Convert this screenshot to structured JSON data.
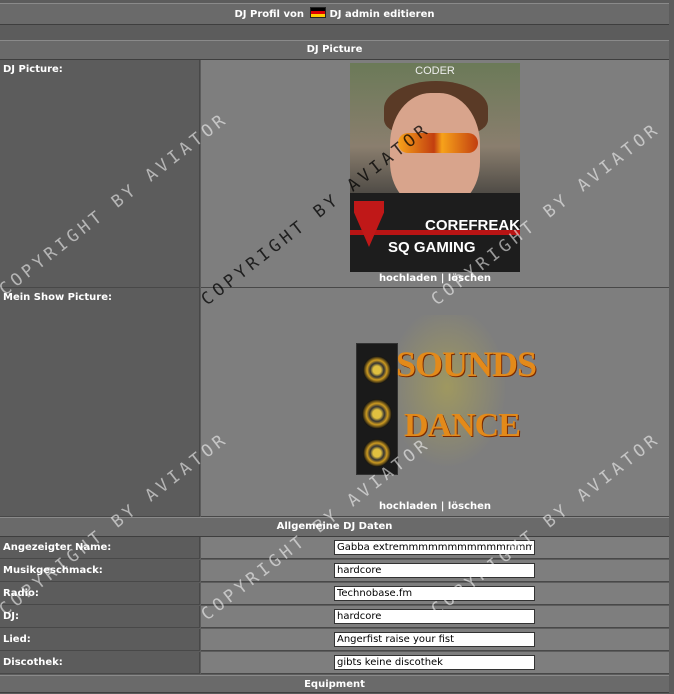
{
  "header": {
    "title_prefix": "DJ Profil von",
    "dj_name": "DJ admin",
    "title_suffix": "editieren",
    "flag_icon": "germany-flag-icon"
  },
  "picture_section": {
    "title": "DJ Picture",
    "dj_picture_label": "DJ Picture:",
    "dj_picture_texts": {
      "top": "CODER",
      "name": "COREFREAK",
      "team": "SQ GAMING"
    },
    "show_picture_label": "Mein Show Picture:",
    "show_picture_texts": {
      "line1": "SOUNDS",
      "line2": "DANCE"
    },
    "upload_label": "hochladen",
    "separator": "|",
    "delete_label": "löschen"
  },
  "general_section": {
    "title": "Allgemeine DJ Daten",
    "fields": [
      {
        "label": "Angezeigter Name:",
        "value": "Gabba extremmmmmmmmmmmmmmmmm"
      },
      {
        "label": "Musikgeschmack:",
        "value": "hardcore"
      },
      {
        "label": "Radio:",
        "value": "Technobase.fm"
      },
      {
        "label": "DJ:",
        "value": "hardcore"
      },
      {
        "label": "Lied:",
        "value": "Angerfist raise your fist"
      },
      {
        "label": "Discothek:",
        "value": "gibts keine discothek"
      }
    ]
  },
  "equipment_section": {
    "title": "Equipment"
  },
  "watermark": "COPYRIGHT BY AVIATOR",
  "colors": {
    "panel_bg": "#5c5c5c",
    "cell_bg": "#7e7e7e",
    "bar_bg": "#6a6a6a"
  }
}
